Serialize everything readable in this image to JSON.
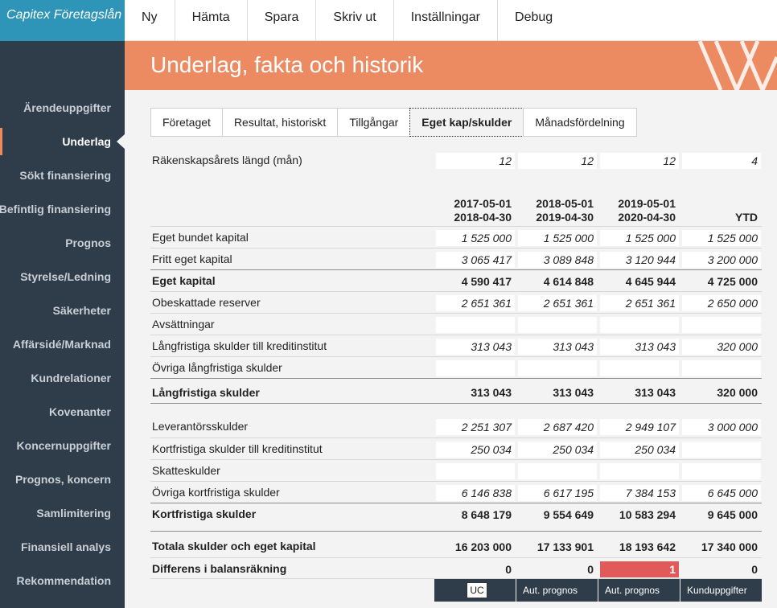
{
  "app": {
    "brand": "Capitex Företagslån"
  },
  "menu": [
    "Ny",
    "Hämta",
    "Spara",
    "Skriv ut",
    "Inställningar",
    "Debug"
  ],
  "sidebar": {
    "items": [
      "Ärendeuppgifter",
      "Underlag",
      "Sökt finansiering",
      "Befintlig finansiering",
      "Prognos",
      "Styrelse/Ledning",
      "Säkerheter",
      "Affärsidé/Marknad",
      "Kundrelationer",
      "Kovenanter",
      "Koncernuppgifter",
      "Prognos, koncern",
      "Samlimitering",
      "Finansiell analys",
      "Rekommendation"
    ],
    "active": "Underlag"
  },
  "header": {
    "title": "Underlag, fakta och historik"
  },
  "tabs": [
    "Företaget",
    "Resultat, historiskt",
    "Tillgångar",
    "Eget kap/skulder",
    "Månadsfördelning"
  ],
  "active_tab": "Eget kap/skulder",
  "period_length": {
    "label": "Räkenskapsårets längd (mån)",
    "values": [
      "12",
      "12",
      "12",
      "4"
    ]
  },
  "columns": [
    {
      "from": "2017-05-01",
      "to": "2018-04-30"
    },
    {
      "from": "2018-05-01",
      "to": "2019-04-30"
    },
    {
      "from": "2019-05-01",
      "to": "2020-04-30"
    },
    {
      "from": "",
      "to": "YTD"
    }
  ],
  "rows": [
    {
      "label": "Eget bundet kapital",
      "values": [
        "1 525 000",
        "1 525 000",
        "1 525 000",
        "1 525 000"
      ]
    },
    {
      "label": "Fritt eget kapital",
      "values": [
        "3 065 417",
        "3 089 848",
        "3 120 944",
        "3 200 000"
      ]
    },
    {
      "label": "Eget kapital",
      "values": [
        "4 590 417",
        "4 614 848",
        "4 645 944",
        "4 725 000"
      ]
    },
    {
      "label": "Obeskattade reserver",
      "values": [
        "2 651 361",
        "2 651 361",
        "2 651 361",
        "2 650 000"
      ]
    },
    {
      "label": "Avsättningar",
      "values": [
        "",
        "",
        "",
        ""
      ]
    },
    {
      "label": "Långfristiga skulder till kreditinstitut",
      "values": [
        "313 043",
        "313 043",
        "313 043",
        "320 000"
      ]
    },
    {
      "label": "Övriga långfristiga skulder",
      "values": [
        "",
        "",
        "",
        ""
      ]
    },
    {
      "label": "Långfristiga skulder",
      "values": [
        "313 043",
        "313 043",
        "313 043",
        "320 000"
      ]
    },
    {
      "label": "Leverantörsskulder",
      "values": [
        "2 251 307",
        "2 687 420",
        "2 949 107",
        "3 000 000"
      ]
    },
    {
      "label": "Kortfristiga skulder till kreditinstitut",
      "values": [
        "250 034",
        "250 034",
        "250 034",
        ""
      ]
    },
    {
      "label": "Skatteskulder",
      "values": [
        "",
        "",
        "",
        ""
      ]
    },
    {
      "label": "Övriga kortfristiga skulder",
      "values": [
        "6 146 838",
        "6 617 195",
        "7 384 153",
        "6 645 000"
      ]
    },
    {
      "label": "Kortfristiga skulder",
      "values": [
        "8 648 179",
        "9 554 649",
        "10 583 294",
        "9 645 000"
      ]
    },
    {
      "label": "Totala skulder och eget kapital",
      "values": [
        "16 203 000",
        "17 133 901",
        "18 193 642",
        "17 340 000"
      ]
    },
    {
      "label": "Differens i balansräkning",
      "values": [
        "0",
        "0",
        "1",
        "0"
      ]
    }
  ],
  "footer": {
    "uc": "UC",
    "buttons": [
      "Aut. prognos",
      "Aut. prognos",
      "Kunduppgifter"
    ]
  },
  "colors": {
    "accent": "#ec8a62",
    "sidebar": "#2f3d4a",
    "brand": "#2f95b8",
    "alert": "#e05a5a"
  }
}
